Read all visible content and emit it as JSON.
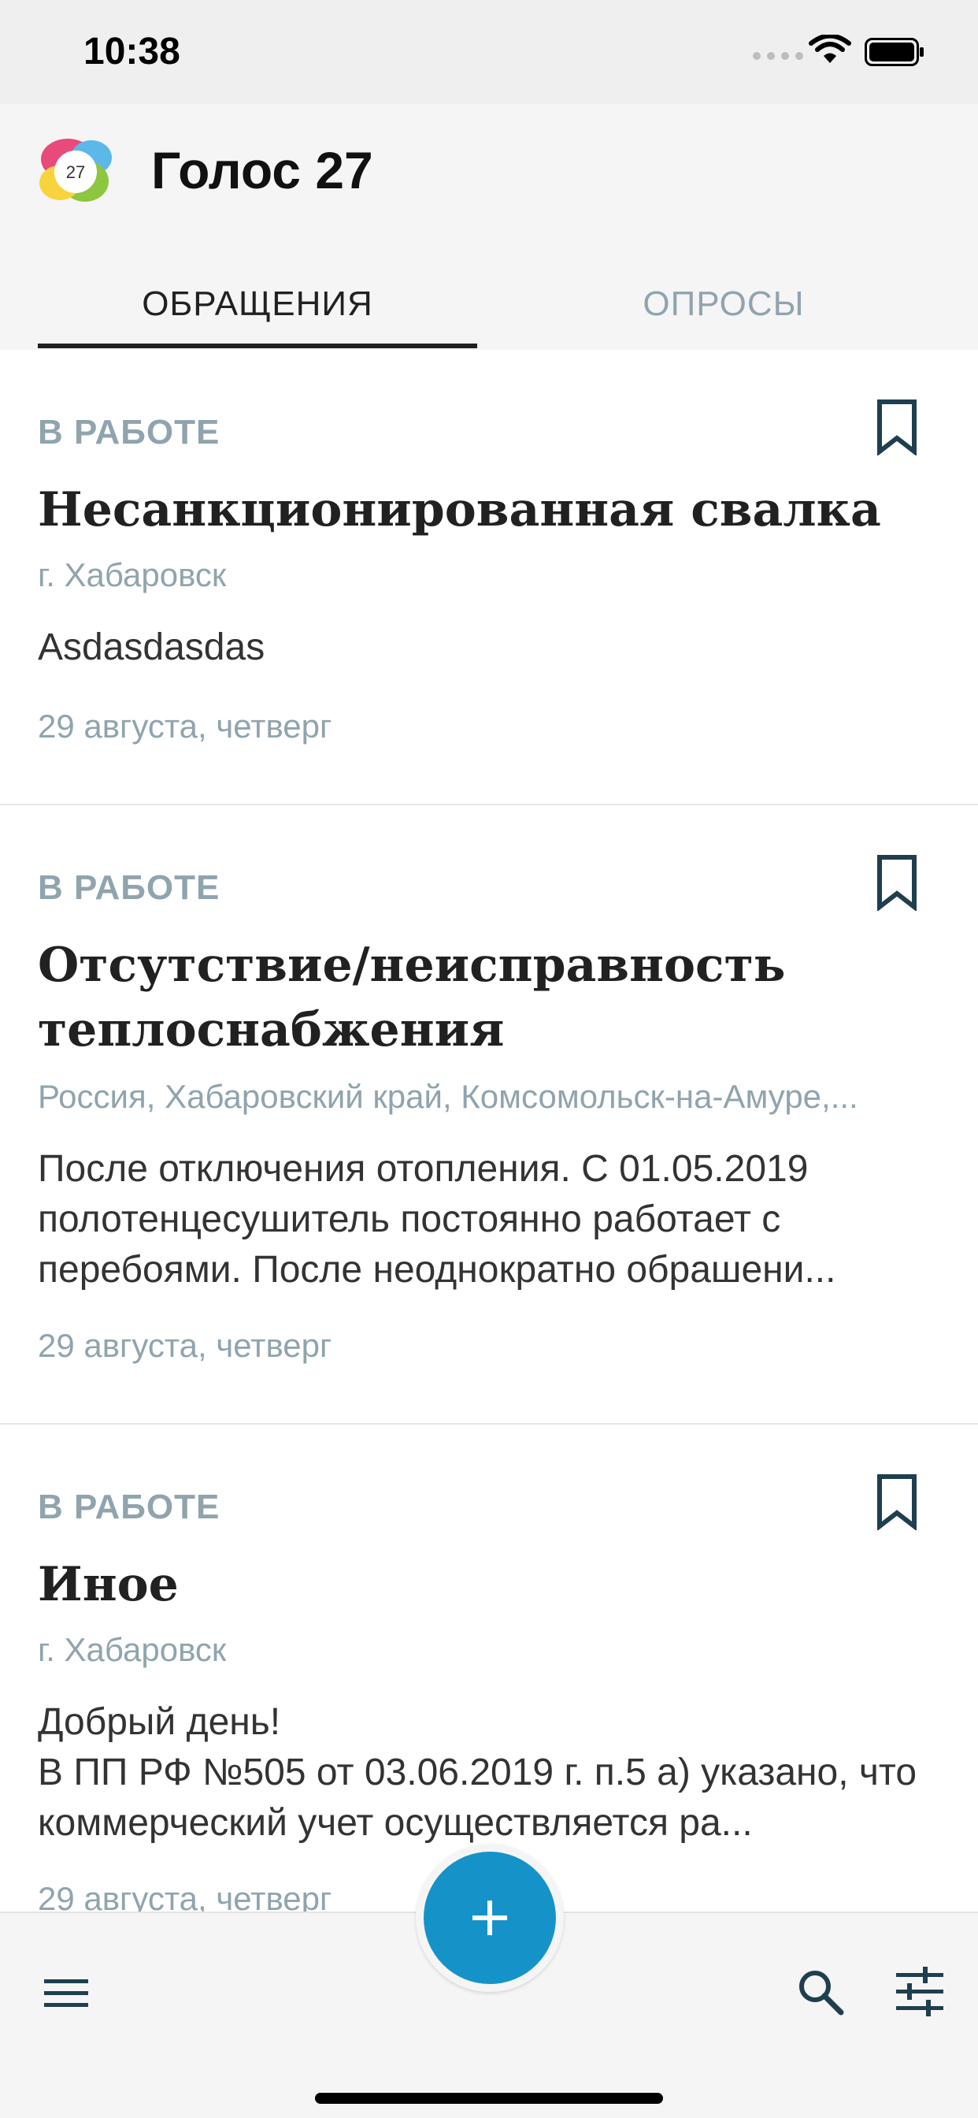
{
  "status_bar": {
    "time": "10:38"
  },
  "app": {
    "title": "Голос 27",
    "logo_text": "27"
  },
  "tabs": [
    {
      "label": "ОБРАЩЕНИЯ"
    },
    {
      "label": "ОПРОСЫ"
    }
  ],
  "items": [
    {
      "status": "В РАБОТЕ",
      "title": "Несанкционированная свалка",
      "location": "г. Хабаровск",
      "body": "Asdasdasdas",
      "date": "29 августа, четверг"
    },
    {
      "status": "В РАБОТЕ",
      "title": "Отсутствие/неисправность теплоснабжения",
      "location": "Россия, Хабаровский край, Комсомольск-на-Амуре,...",
      "body": "После отключения отопления. С 01.05.2019 полотенцесушитель постоянно работает с перебоями. После неоднократно обрашени...",
      "date": "29 августа, четверг"
    },
    {
      "status": "В РАБОТЕ",
      "title": "Иное",
      "location": "г. Хабаровск",
      "body": "Добрый день!\nВ ПП РФ №505 от 03.06.2019 г. п.5 а) указано, что коммерческий учет осуществляется ра...",
      "date": "29 августа, четверг"
    }
  ],
  "colors": {
    "accent": "#1593c8",
    "muted": "#90a4ae",
    "icon": "#1f3f4f"
  },
  "icons": {
    "bookmark": "bookmark-icon",
    "menu": "menu-icon",
    "search": "search-icon",
    "filter": "filter-icon",
    "add": "plus-icon"
  }
}
